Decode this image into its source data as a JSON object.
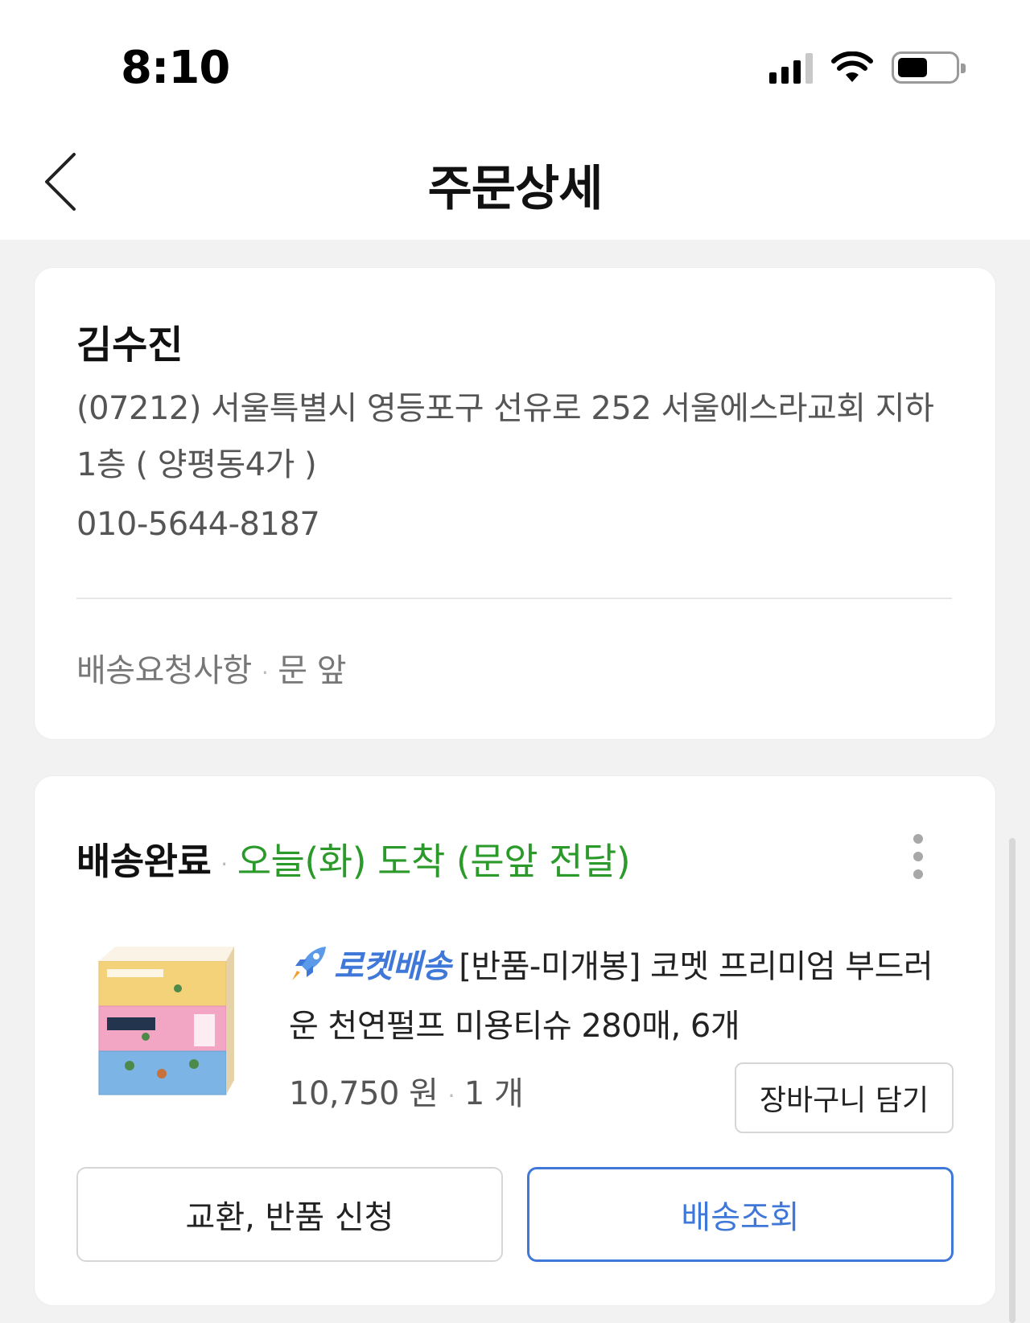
{
  "status_bar": {
    "time": "8:10",
    "icons": [
      "signal-icon",
      "wifi-icon",
      "battery-icon"
    ]
  },
  "header": {
    "title": "주문상세",
    "back_icon": "chevron-left-icon"
  },
  "recipient": {
    "name": "김수진",
    "address": "(07212) 서울특별시 영등포구 선유로 252 서울에스라교회 지하 1층 ( 양평동4가 )",
    "phone": "010-5644-8187",
    "request_label": "배송요청사항",
    "request_value": "문 앞"
  },
  "delivery": {
    "status_label": "배송완료",
    "arrival_text": "오늘(화) 도착 (문앞 전달)",
    "arrival_color": "#2b9a2b",
    "more_icon": "more-vertical-icon",
    "product": {
      "badge": "로켓배송",
      "badge_color": "#3f78d8",
      "badge_icon": "rocket-icon",
      "title": "[반품-미개봉] 코멧 프리미엄 부드러운 천연펄프 미용티슈 280매, 6개",
      "price": "10,750 원",
      "quantity": "1 개"
    },
    "cart_button": "장바구니 담기",
    "exchange_button": "교환, 반품 신청",
    "track_button": "배송조회",
    "accent_color": "#3f78d8"
  }
}
